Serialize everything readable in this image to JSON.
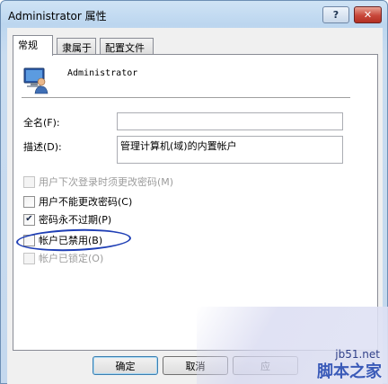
{
  "window": {
    "title": "Administrator 属性",
    "help_button": "?",
    "close_button": "✕"
  },
  "tabs": [
    {
      "label": "常规",
      "active": true
    },
    {
      "label": "隶属于",
      "active": false
    },
    {
      "label": "配置文件",
      "active": false
    }
  ],
  "user": {
    "icon": "user-computer-icon",
    "name": "Administrator"
  },
  "fields": {
    "full_name_label": "全名(F):",
    "full_name_value": "",
    "description_label": "描述(D):",
    "description_value": "管理计算机(域)的内置帐户"
  },
  "checkboxes": [
    {
      "label": "用户下次登录时须更改密码(M)",
      "checked": false,
      "enabled": false
    },
    {
      "label": "用户不能更改密码(C)",
      "checked": false,
      "enabled": true
    },
    {
      "label": "密码永不过期(P)",
      "checked": true,
      "enabled": true
    },
    {
      "label": "帐户已禁用(B)",
      "checked": false,
      "enabled": true
    },
    {
      "label": "帐户已锁定(O)",
      "checked": false,
      "enabled": false
    }
  ],
  "buttons": {
    "ok": "确定",
    "cancel": "取消",
    "apply": "应"
  },
  "watermark": {
    "url": "jb51.net",
    "site": "脚本之家"
  },
  "colors": {
    "annotation": "#1f3fb5",
    "close_button": "#c8473a",
    "watermark": "#3a5ab8"
  }
}
